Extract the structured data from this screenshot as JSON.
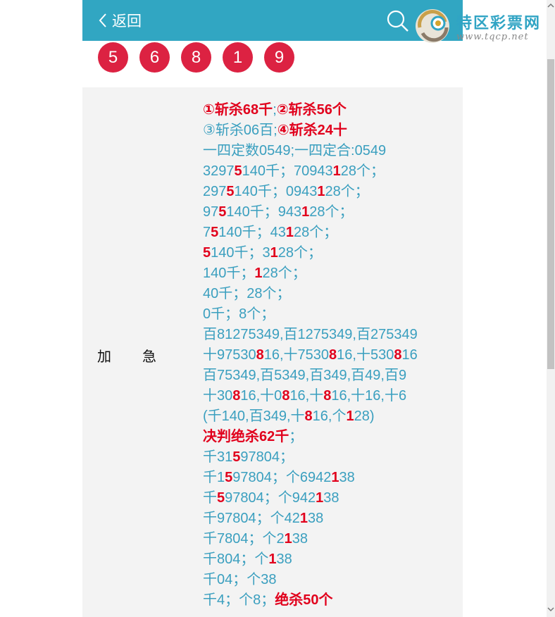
{
  "header": {
    "back_label": "返回"
  },
  "logo": {
    "title": "特区彩票网",
    "url": "www.tqcp.net"
  },
  "balls": [
    "5",
    "6",
    "8",
    "1",
    "9"
  ],
  "row": {
    "label_a": "加",
    "label_b": "急"
  },
  "lines": [
    [
      {
        "t": "①斩杀68千",
        "r": true
      },
      {
        "t": ";"
      },
      {
        "t": "②斩杀56个",
        "r": true
      }
    ],
    [
      {
        "t": "③斩杀06百;"
      },
      {
        "t": "④斩杀24十",
        "r": true
      }
    ],
    [
      {
        "t": "一四定数0549;一四定合:0549"
      }
    ],
    [
      {
        "t": "3297"
      },
      {
        "t": "5",
        "r": true
      },
      {
        "t": "140千；70943"
      },
      {
        "t": "1",
        "r": true
      },
      {
        "t": "28个；"
      }
    ],
    [
      {
        "t": "297"
      },
      {
        "t": "5",
        "r": true
      },
      {
        "t": "140千；0943"
      },
      {
        "t": "1",
        "r": true
      },
      {
        "t": "28个；"
      }
    ],
    [
      {
        "t": "97"
      },
      {
        "t": "5",
        "r": true
      },
      {
        "t": "140千；943"
      },
      {
        "t": "1",
        "r": true
      },
      {
        "t": "28个；"
      }
    ],
    [
      {
        "t": "7"
      },
      {
        "t": "5",
        "r": true
      },
      {
        "t": "140千；43"
      },
      {
        "t": "1",
        "r": true
      },
      {
        "t": "28个；"
      }
    ],
    [
      {
        "t": "5",
        "r": true
      },
      {
        "t": "140千；3"
      },
      {
        "t": "1",
        "r": true
      },
      {
        "t": "28个；"
      }
    ],
    [
      {
        "t": "140千；"
      },
      {
        "t": "1",
        "r": true
      },
      {
        "t": "28个；"
      }
    ],
    [
      {
        "t": "40千；28个；"
      }
    ],
    [
      {
        "t": "0千；8个；"
      }
    ],
    [
      {
        "t": "百81275349,百1275349,百275349"
      }
    ],
    [
      {
        "t": "十97530"
      },
      {
        "t": "8",
        "r": true
      },
      {
        "t": "16,十7530"
      },
      {
        "t": "8",
        "r": true
      },
      {
        "t": "16,十530"
      },
      {
        "t": "8",
        "r": true
      },
      {
        "t": "16"
      }
    ],
    [
      {
        "t": "百75349,百5349,百349,百49,百9"
      }
    ],
    [
      {
        "t": "十30"
      },
      {
        "t": "8",
        "r": true
      },
      {
        "t": "16,十0"
      },
      {
        "t": "8",
        "r": true
      },
      {
        "t": "16,十"
      },
      {
        "t": "8",
        "r": true
      },
      {
        "t": "16,十16,十6"
      }
    ],
    [
      {
        "t": "(千140,百349,十"
      },
      {
        "t": "8",
        "r": true
      },
      {
        "t": "16,个"
      },
      {
        "t": "1",
        "r": true
      },
      {
        "t": "28)"
      }
    ],
    [
      {
        "t": "决判绝杀62千",
        "r": true
      },
      {
        "t": "；"
      }
    ],
    [
      {
        "t": "千31"
      },
      {
        "t": "5",
        "r": true
      },
      {
        "t": "97804；"
      }
    ],
    [
      {
        "t": "千1"
      },
      {
        "t": "5",
        "r": true
      },
      {
        "t": "97804；个6942"
      },
      {
        "t": "1",
        "r": true
      },
      {
        "t": "38"
      }
    ],
    [
      {
        "t": "千"
      },
      {
        "t": "5",
        "r": true
      },
      {
        "t": "97804；个942"
      },
      {
        "t": "1",
        "r": true
      },
      {
        "t": "38"
      }
    ],
    [
      {
        "t": "千97804；个42"
      },
      {
        "t": "1",
        "r": true
      },
      {
        "t": "38"
      }
    ],
    [
      {
        "t": "千7804；个2"
      },
      {
        "t": "1",
        "r": true
      },
      {
        "t": "38"
      }
    ],
    [
      {
        "t": "千804；个"
      },
      {
        "t": "1",
        "r": true
      },
      {
        "t": "38"
      }
    ],
    [
      {
        "t": "千04；个38"
      }
    ],
    [
      {
        "t": "千4；个8；"
      },
      {
        "t": "绝杀50个",
        "r": true
      }
    ]
  ],
  "colors": {
    "header_bg": "#31a6c2",
    "ball_bg": "#dc2242",
    "text_blue": "#3a9fbf",
    "text_red": "#e1001c",
    "panel_bg": "#f3f3f3"
  }
}
